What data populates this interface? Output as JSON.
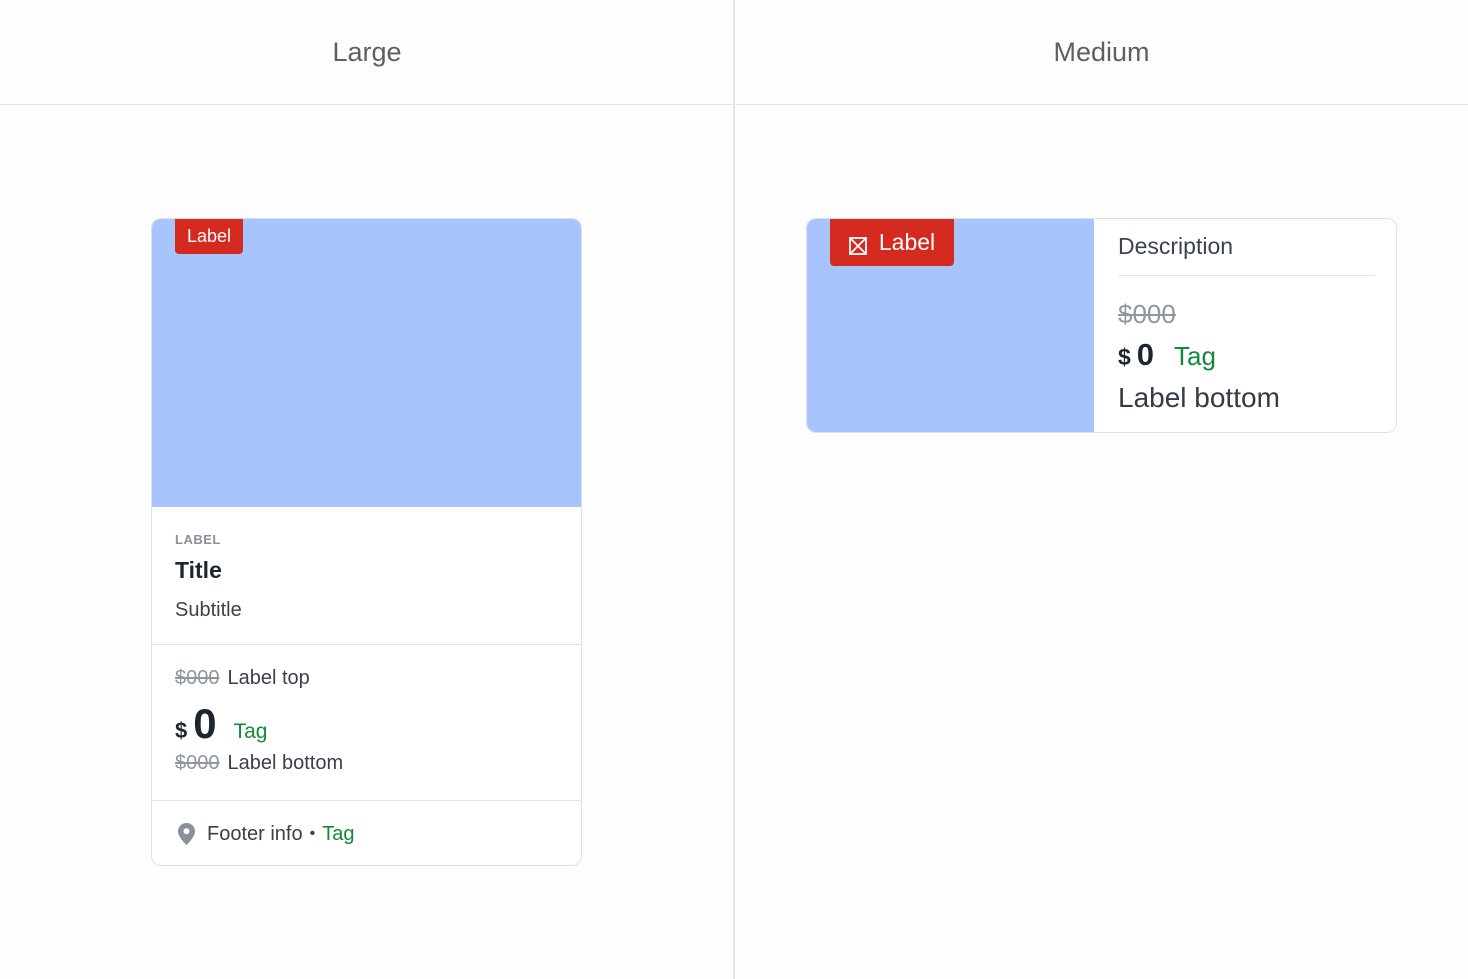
{
  "columns": {
    "left_header": "Large",
    "right_header": "Medium"
  },
  "large_card": {
    "badge": "Label",
    "overline": "LABEL",
    "title": "Title",
    "subtitle": "Subtitle",
    "price_top_strike": "$000",
    "label_top": "Label top",
    "currency": "$",
    "amount": "0",
    "tag": "Tag",
    "price_bottom_strike": "$000",
    "label_bottom": "Label bottom",
    "footer_info": "Footer info",
    "footer_separator": "•",
    "footer_tag": "Tag"
  },
  "medium_card": {
    "badge": "Label",
    "description": "Description",
    "price_strike": "$000",
    "currency": "$",
    "amount": "0",
    "tag": "Tag",
    "label_bottom": "Label bottom"
  },
  "colors": {
    "media": "#a7c4fd",
    "badge": "#d42a20",
    "tag": "#138a3b"
  },
  "icons": {
    "footer": "location-pin-icon",
    "medium_badge": "image-placeholder-icon"
  }
}
